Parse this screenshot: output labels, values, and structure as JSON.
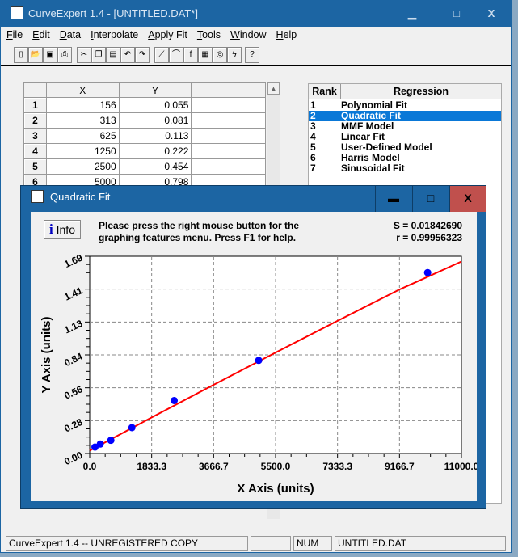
{
  "app": {
    "title": "CurveExpert 1.4 - [UNTITLED.DAT*]",
    "min": "▁",
    "max": "□",
    "close": "X"
  },
  "menu": [
    "File",
    "Edit",
    "Data",
    "Interpolate",
    "Apply Fit",
    "Tools",
    "Window",
    "Help"
  ],
  "toolbar": [
    "new-icon",
    "open-icon",
    "save-icon",
    "print-icon",
    "cut-icon",
    "copy-icon",
    "paste-icon",
    "undo-icon",
    "redo-icon",
    "linear-fit-icon",
    "curve-fit-icon",
    "function-icon",
    "keyboard-icon",
    "lightbulb-icon",
    "lightning-icon",
    "help-icon"
  ],
  "grid": {
    "headers": [
      "",
      "X",
      "Y",
      ""
    ],
    "rows": [
      [
        "1",
        "156",
        "0.055"
      ],
      [
        "2",
        "313",
        "0.081"
      ],
      [
        "3",
        "625",
        "0.113"
      ],
      [
        "4",
        "1250",
        "0.222"
      ],
      [
        "5",
        "2500",
        "0.454"
      ],
      [
        "6",
        "5000",
        "0.798"
      ]
    ]
  },
  "ranking": {
    "headers": [
      "Rank",
      "Regression"
    ],
    "selected": 1,
    "rows": [
      [
        "1",
        "Polynomial Fit"
      ],
      [
        "2",
        "Quadratic Fit"
      ],
      [
        "3",
        "MMF Model"
      ],
      [
        "4",
        "Linear Fit"
      ],
      [
        "5",
        "User-Defined Model"
      ],
      [
        "6",
        "Harris Model"
      ],
      [
        "7",
        "Sinusoidal Fit"
      ]
    ]
  },
  "status": {
    "main": "CurveExpert 1.4 -- UNREGISTERED COPY",
    "blank": "",
    "num": "NUM",
    "file": "UNTITLED.DAT"
  },
  "child": {
    "title": "Quadratic Fit",
    "min": "▬",
    "max": "□",
    "close": "X",
    "info_label": "Info",
    "msg1": "Please press the right mouse button for the",
    "msg2": "graphing features menu.  Press F1 for help.",
    "s": "S = 0.01842690",
    "r": "r = 0.99956323"
  },
  "chart_data": {
    "type": "scatter",
    "xlabel": "X Axis (units)",
    "ylabel": "Y Axis (units)",
    "xlim": [
      0,
      11000
    ],
    "ylim": [
      0,
      1.69
    ],
    "xticks": [
      "0.0",
      "1833.3",
      "3666.7",
      "5500.0",
      "7333.3",
      "9166.7",
      "11000.0"
    ],
    "yticks": [
      "0.00",
      "0.28",
      "0.56",
      "0.84",
      "1.13",
      "1.41",
      "1.69"
    ],
    "grid": true,
    "points": {
      "x": [
        156,
        313,
        625,
        1250,
        2500,
        5000,
        10000
      ],
      "y": [
        0.055,
        0.081,
        0.113,
        0.222,
        0.454,
        0.798,
        1.55
      ]
    },
    "fit": {
      "x": [
        0,
        1833.3,
        3666.7,
        5500,
        7333.3,
        9166.7,
        11000
      ],
      "y": [
        0.025,
        0.309,
        0.589,
        0.865,
        1.137,
        1.405,
        1.645
      ]
    },
    "colors": {
      "points": "#0000ff",
      "fit": "#ff0000"
    }
  }
}
